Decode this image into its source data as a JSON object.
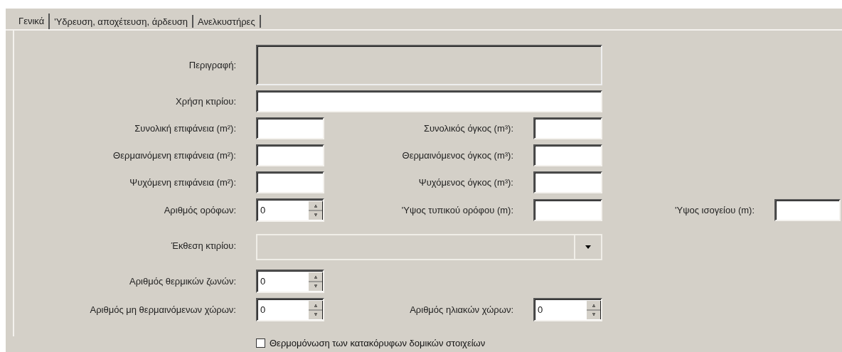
{
  "tabs": [
    {
      "label": "Γενικά",
      "selected": true
    },
    {
      "label": "'Υδρευση, αποχέτευση, άρδευση",
      "selected": false
    },
    {
      "label": "Ανελκυστήρες",
      "selected": false
    }
  ],
  "form": [
    {
      "items": [
        {
          "label": "Περιγραφή:",
          "kind": "textarea",
          "disabled": true
        }
      ]
    },
    {
      "items": [
        {
          "label": "Χρήση κτιρίου:",
          "kind": "text",
          "disabled": false
        }
      ]
    },
    {
      "items": [
        {
          "label": "Συνολική επιφάνεια (m²):",
          "kind": "text",
          "disabled": false
        },
        {
          "label": "Συνολικός όγκος (m³):",
          "kind": "text",
          "disabled": false
        }
      ]
    },
    {
      "items": [
        {
          "label": "Θερμαινόμενη επιφάνεια (m²):",
          "kind": "text",
          "disabled": false
        },
        {
          "label": "Θερμαινόμενος όγκος (m³):",
          "kind": "text",
          "disabled": false
        }
      ]
    },
    {
      "items": [
        {
          "label": "Ψυχόμενη επιφάνεια (m²):",
          "kind": "text",
          "disabled": false
        },
        {
          "label": "Ψυχόμενος όγκος (m³):",
          "kind": "text",
          "disabled": false
        }
      ]
    },
    {
      "items": [
        {
          "label": "Αριθμός ορόφων:",
          "kind": "spinner",
          "value": "0",
          "disabled": false
        },
        {
          "label": "'Υψος τυπικού ορόφου (m):",
          "kind": "text",
          "disabled": false
        },
        {
          "label": "'Υψος ισογείου (m):",
          "kind": "text",
          "disabled": false
        }
      ]
    },
    {
      "items": [
        {
          "label": "Έκθεση κτιρίου:",
          "kind": "combo",
          "disabled": true
        }
      ]
    },
    {
      "items": [
        {
          "label": "Αριθμός θερμικών ζωνών:",
          "kind": "spinner",
          "value": "0",
          "disabled": false
        }
      ]
    },
    {
      "items": [
        {
          "label": "Αριθμός μη θερμαινόμενων χώρων:",
          "kind": "spinner",
          "value": "0",
          "disabled": false
        },
        {
          "label": "Αριθμός ηλιακών χώρων:",
          "kind": "spinner",
          "value": "0",
          "disabled": false
        }
      ]
    }
  ],
  "checkbox": {
    "label": "Θερμομόνωση των κατακόρυφων δομικών στοιχείων",
    "checked": false
  }
}
